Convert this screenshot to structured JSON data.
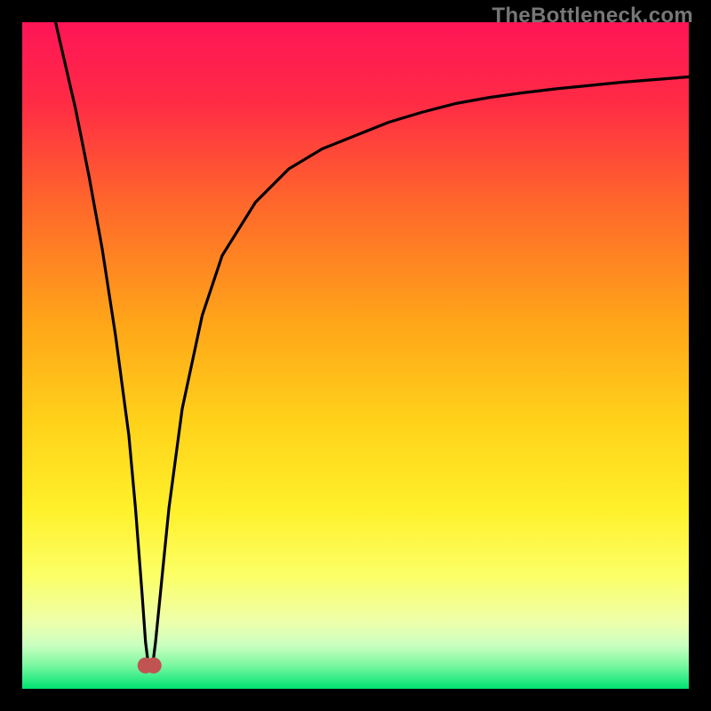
{
  "watermark": "TheBottleneck.com",
  "colors": {
    "frame": "#000000",
    "gradient_top": "#ff1557",
    "gradient_mid1": "#ff5a2f",
    "gradient_mid2": "#ffb100",
    "gradient_mid3": "#ffe924",
    "gradient_low1": "#f8ff8a",
    "gradient_low2": "#d6ffb0",
    "gradient_bottom": "#00e472",
    "trace": "#000000",
    "marker": "#c15452"
  },
  "chart_data": {
    "type": "line",
    "title": "",
    "xlabel": "",
    "ylabel": "",
    "x_range": [
      0,
      100
    ],
    "y_range": [
      0,
      100
    ],
    "series": [
      {
        "name": "bottleneck-curve",
        "x": [
          5,
          8,
          10,
          12,
          14,
          16,
          17,
          18,
          18.5,
          19,
          19.5,
          20,
          21,
          22,
          24,
          27,
          30,
          35,
          40,
          45,
          50,
          55,
          60,
          65,
          70,
          75,
          80,
          85,
          90,
          95,
          100
        ],
        "y": [
          100,
          87,
          77,
          66,
          53,
          38,
          27,
          14,
          7,
          3,
          3,
          7,
          17,
          27,
          42,
          56,
          65,
          73,
          78,
          81,
          83,
          85,
          86.5,
          87.8,
          88.7,
          89.4,
          90,
          90.5,
          91,
          91.4,
          91.8
        ]
      }
    ],
    "markers": [
      {
        "name": "min-left",
        "x": 18.5,
        "y": 3.5
      },
      {
        "name": "min-right",
        "x": 19.7,
        "y": 3.5
      }
    ],
    "minimum_x": 19,
    "notes": "V-shaped bottleneck curve; y is percentage bottleneck (0 at green bottom, 100 at red top). Values estimated from pixel positions; no axis ticks or labels are rendered in the original image."
  }
}
